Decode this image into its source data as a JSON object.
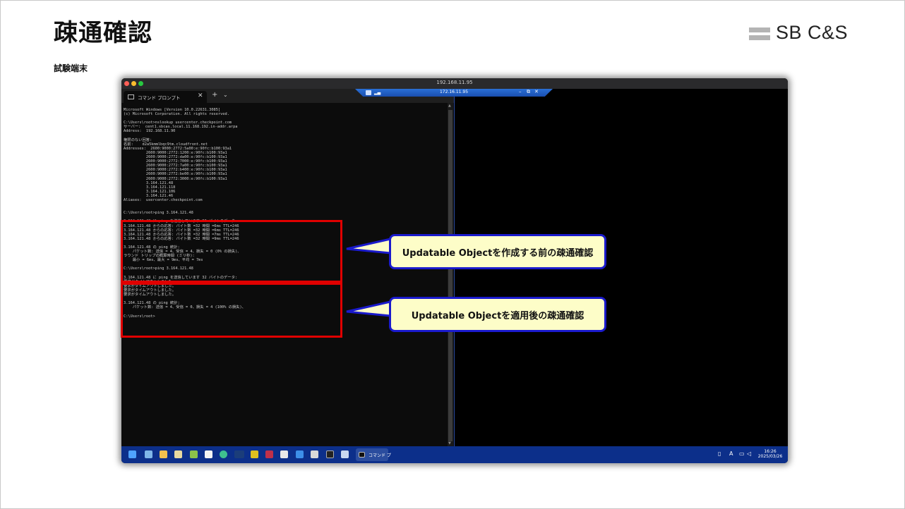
{
  "slide": {
    "title": "疎通確認",
    "subtitle": "試験端末",
    "logo": "SB C&S"
  },
  "window": {
    "mac_title": "192.168.11.95",
    "rdp_ip": "172.16.11.95",
    "rdp_controls": [
      "–",
      "⧉",
      "✕"
    ]
  },
  "terminal": {
    "tab_label": "コマンド プロンプト",
    "tab_close": "✕",
    "tab_new": "+",
    "tab_menu": "⌄",
    "output": "Microsoft Windows [Version 10.0.22631.3085]\n(c) Microsoft Corporation. All rights reserved.\n\nC:\\Users\\root>nslookup usercenter.checkpoint.com\nサーバー:  cent1.sbcas.local.11.168.192.in-addr.arpa\nAddress:  192.168.11.90\n\n権限のない回答:\n名前:    d2a5kmmlbqc9tm.cloudfront.net\nAddresses:  2600:9000:2772:5a00:e:90fc:b100:93a1\n          2600:9000:2772:1200:e:90fc:b100:93a1\n          2600:9000:2772:da00:e:90fc:b100:93a1\n          2600:9000:2772:7000:e:90fc:b100:93a1\n          2600:9000:2772:7a00:e:90fc:b100:93a1\n          2600:9000:2772:b400:e:90fc:b100:93a1\n          2600:9000:2772:be00:e:90fc:b100:93a1\n          2600:9000:2772:3000:e:90fc:b100:93a1\n          3.164.121.48\n          3.164.121.118\n          3.164.121.106\n          3.164.121.46\nAliases:  usercenter.checkpoint.com\n\n\nC:\\Users\\root>ping 3.164.121.48\n\n3.164.121.48 に ping を送信しています 32 バイトのデータ:\n3.164.121.48 からの応答: バイト数 =32 時間 =6ms TTL=246\n3.164.121.48 からの応答: バイト数 =32 時間 =6ms TTL=246\n3.164.121.48 からの応答: バイト数 =32 時間 =7ms TTL=246\n3.164.121.48 からの応答: バイト数 =32 時間 =9ms TTL=246\n\n3.164.121.48 の ping 統計:\n    パケット数: 送信 = 4、受信 = 4、損失 = 0 (0% の損失)、\nラウンド トリップの概算時間 (ミリ秒):\n    最小 = 6ms、最大 = 9ms、平均 = 7ms\n\nC:\\Users\\root>ping 3.164.121.48\n\n3.164.121.48 に ping を送信しています 32 バイトのデータ:\n要求がタイムアウトしました。\n要求がタイムアウトしました。\n要求がタイムアウトしました。\n要求がタイムアウトしました。\n\n3.164.121.48 の ping 統計:\n    パケット数: 送信 = 4、受信 = 0、損失 = 4 (100% の損失)、\n\nC:\\Users\\root>"
  },
  "taskbar": {
    "cmd_label": "コマンド プ",
    "clock_time": "16:26",
    "clock_date": "2025/03/26",
    "tray_ime": "A"
  },
  "callouts": {
    "before": "Updatable Objectを作成する前の疎通確認",
    "after": "Updatable Objectを適用後の疎通確認"
  },
  "colors": {
    "highlight_box": "#e00000",
    "callout_border": "#1a1acc",
    "callout_fill": "#fdfdc8",
    "taskbar": "#0c2f8a"
  }
}
